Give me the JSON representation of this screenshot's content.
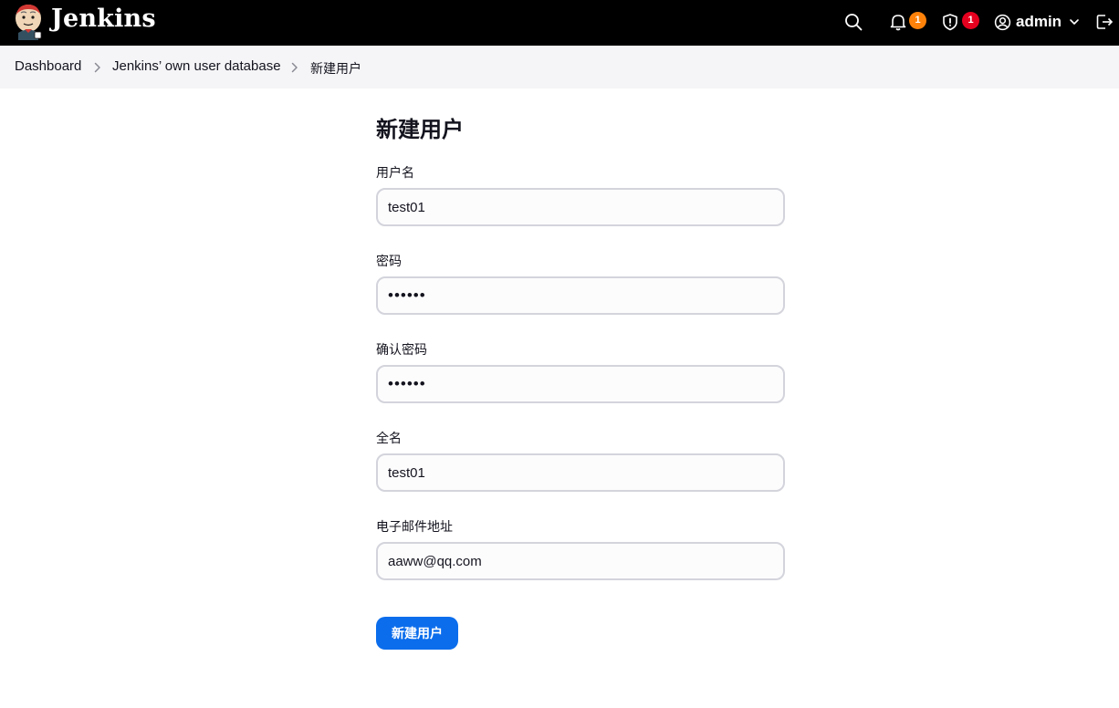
{
  "header": {
    "brand": "Jenkins",
    "logo_icon": "jenkins-butler-logo",
    "search_icon": "search-icon",
    "notifications": {
      "icon": "bell-icon",
      "count": "1",
      "badge_color": "#fe820a"
    },
    "security": {
      "icon": "shield-icon",
      "count": "1",
      "badge_color": "#e6001f"
    },
    "user": {
      "icon": "user-circle-icon",
      "name": "admin",
      "chevron": "chevron-down-icon"
    },
    "logout_icon": "logout-icon"
  },
  "breadcrumb": {
    "items": [
      "Dashboard",
      "Jenkins’ own user database",
      "新建用户"
    ],
    "separator_icon": "chevron-right-icon"
  },
  "form": {
    "title": "新建用户",
    "fields": [
      {
        "label": "用户名",
        "value": "test01",
        "type": "text"
      },
      {
        "label": "密码",
        "value": "••••••",
        "type": "password"
      },
      {
        "label": "确认密码",
        "value": "••••••",
        "type": "password"
      },
      {
        "label": "全名",
        "value": "test01",
        "type": "text"
      },
      {
        "label": "电子邮件地址",
        "value": "aaww@qq.com",
        "type": "text"
      }
    ],
    "submit_label": "新建用户"
  },
  "colors": {
    "header_bg": "#000000",
    "breadcrumb_bg": "#f5f5f7",
    "accent": "#0b6dec",
    "field_border": "#d3d4dc"
  }
}
